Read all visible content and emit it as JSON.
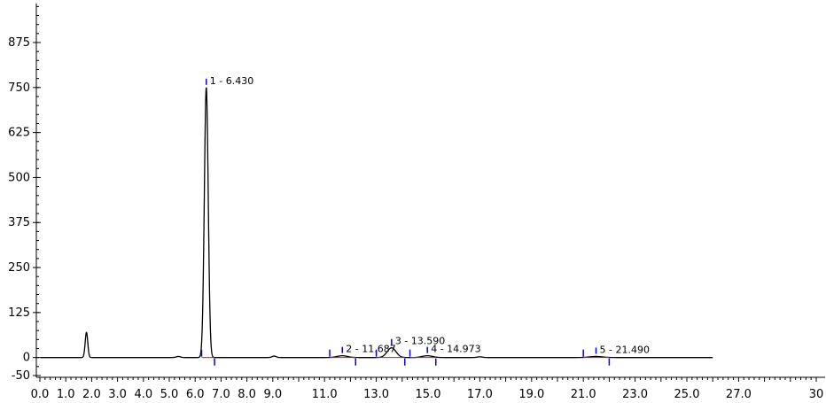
{
  "chart_data": {
    "type": "line",
    "title": "",
    "xlabel": "",
    "ylabel": "",
    "xlim": [
      0,
      30
    ],
    "ylim": [
      -50,
      1000
    ],
    "grid": false,
    "y_ticks": [
      {
        "value": -50,
        "label": "-50"
      },
      {
        "value": 0,
        "label": "0"
      },
      {
        "value": 125,
        "label": "125"
      },
      {
        "value": 250,
        "label": "250"
      },
      {
        "value": 375,
        "label": "375"
      },
      {
        "value": 500,
        "label": "500"
      },
      {
        "value": 625,
        "label": "625"
      },
      {
        "value": 750,
        "label": "750"
      },
      {
        "value": 875,
        "label": "875"
      }
    ],
    "x_ticks": [
      {
        "value": 0.0,
        "label": "0.0"
      },
      {
        "value": 1.0,
        "label": "1.0"
      },
      {
        "value": 2.0,
        "label": "2.0"
      },
      {
        "value": 3.0,
        "label": "3.0"
      },
      {
        "value": 4.0,
        "label": "4.0"
      },
      {
        "value": 5.0,
        "label": "5.0"
      },
      {
        "value": 6.0,
        "label": "6.0"
      },
      {
        "value": 7.0,
        "label": "7.0"
      },
      {
        "value": 8.0,
        "label": "8.0"
      },
      {
        "value": 9.0,
        "label": "9.0"
      },
      {
        "value": 11.0,
        "label": "11.0"
      },
      {
        "value": 13.0,
        "label": "13.0"
      },
      {
        "value": 15.0,
        "label": "15.0"
      },
      {
        "value": 17.0,
        "label": "17.0"
      },
      {
        "value": 19.0,
        "label": "19.0"
      },
      {
        "value": 21.0,
        "label": "21.0"
      },
      {
        "value": 23.0,
        "label": "23.0"
      },
      {
        "value": 25.0,
        "label": "25.0"
      },
      {
        "value": 27.0,
        "label": "27.0"
      },
      {
        "value": 30.0,
        "label": "30"
      }
    ],
    "trace_end": 26.0,
    "peaks": [
      {
        "rt": 1.8,
        "height": 70,
        "width": 0.05,
        "label": ""
      },
      {
        "rt": 5.35,
        "height": 3,
        "width": 0.08,
        "label": ""
      },
      {
        "rt": 6.43,
        "height": 750,
        "width": 0.075,
        "label": "1 - 6.430",
        "start": 6.25,
        "end": 6.75
      },
      {
        "rt": 9.05,
        "height": 4,
        "width": 0.08,
        "label": ""
      },
      {
        "rt": 11.687,
        "height": 5,
        "width": 0.2,
        "label": "2 - 11.687",
        "start": 11.2,
        "end": 12.2
      },
      {
        "rt": 13.59,
        "height": 27,
        "width": 0.17,
        "label": "3 - 13.590",
        "start": 13.0,
        "end": 14.1
      },
      {
        "rt": 14.973,
        "height": 5,
        "width": 0.2,
        "label": "4 - 14.973",
        "start": 14.3,
        "end": 15.3
      },
      {
        "rt": 17.0,
        "height": 2,
        "width": 0.1,
        "label": ""
      },
      {
        "rt": 21.49,
        "height": 3,
        "width": 0.25,
        "label": "5 - 21.490",
        "start": 21.0,
        "end": 22.0
      }
    ],
    "colors": {
      "trace": "#000000",
      "baseline": "#ff0000",
      "marker": "#0000ff",
      "axis": "#000000"
    }
  }
}
